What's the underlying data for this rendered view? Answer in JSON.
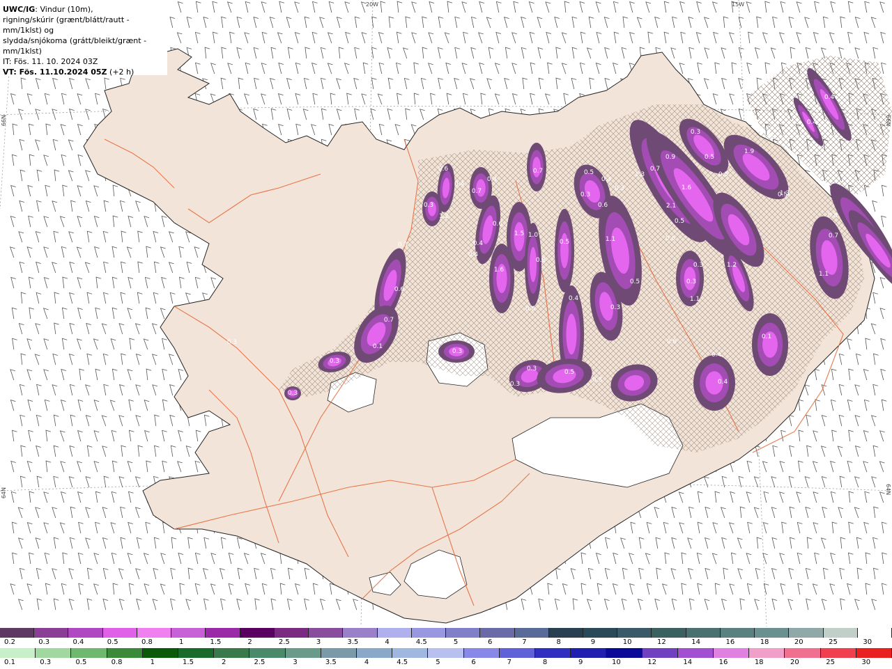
{
  "header": {
    "model": "UWC/IG",
    "title_rest": ": Vindur (10m),",
    "line2": "rigning/skúrir (grænt/blátt/rautt - mm/1klst) og",
    "line3": "slydda/snjókoma (grátt/bleikt/grænt - mm/1klst)",
    "line4": "IT: Fös. 11. 10. 2024 03Z",
    "line5_bold": "VT: Fös. 11.10.2024 05Z",
    "line5_rest": "(+2 h)"
  },
  "graticule": {
    "lon_top_left": "20W",
    "lon_top_right": "15W",
    "lat_upper_left": "66N",
    "lat_upper_right": "66N",
    "lat_lower_left": "64N",
    "lat_lower_right": "64N"
  },
  "precip_labels": [
    "0.4",
    "0.4",
    "0.3",
    "0.5",
    "1.9",
    "0.5",
    "0.5",
    "1.3",
    "0.7",
    "0.9",
    "1.6",
    "2.1",
    "0.5",
    "0.5",
    "0.4",
    "0.3",
    "0.6",
    "0.3",
    "0.6",
    "0.7",
    "0.4",
    "0.7",
    "0.4",
    "0.3",
    "1.2",
    "0.6",
    "0.4",
    "0.4",
    "1.6",
    "1.5",
    "1.0",
    "0.5",
    "1.1",
    "0.6",
    "0.8",
    "0.3",
    "0.4",
    "0.5",
    "0.3",
    "0.3",
    "0.6",
    "0.3",
    "1.1",
    "1.2",
    "1.3",
    "0.8",
    "0.7",
    "1.1",
    "0.6",
    "0.7",
    "0.6",
    "0.3",
    "0.1",
    "0.1",
    "0.3",
    "0.3",
    "0.3",
    "0.3",
    "0.5",
    "0.3",
    "0.4",
    "0.4",
    "0.3"
  ],
  "scale_snow": {
    "labels": [
      "0.2",
      "0.3",
      "0.4",
      "0.5",
      "0.8",
      "1",
      "1.5",
      "2",
      "2.5",
      "3",
      "3.5",
      "4",
      "4.5",
      "5",
      "6",
      "7",
      "8",
      "9",
      "10",
      "12",
      "14",
      "16",
      "18",
      "20",
      "25",
      "30"
    ],
    "colors": [
      "#5e3a63",
      "#8a3e96",
      "#b048c2",
      "#e060e8",
      "#f080f0",
      "#c860d8",
      "#9a2aa8",
      "#5a0060",
      "#7a2a80",
      "#8a4c9c",
      "#9a80c8",
      "#b0b0ee",
      "#9898e0",
      "#8080c8",
      "#6a6aa8",
      "#5a6a98",
      "#2a4050",
      "#2a4a5a",
      "#3a5a68",
      "#3a6060",
      "#4a7070",
      "#5a8080",
      "#6a9090",
      "#90a8a8",
      "#c0d0c8",
      "#ffffff"
    ]
  },
  "scale_rain": {
    "labels": [
      "0.1",
      "0.3",
      "0.5",
      "0.8",
      "1",
      "1.5",
      "2",
      "2.5",
      "3",
      "3.5",
      "4",
      "4.5",
      "5",
      "6",
      "7",
      "8",
      "9",
      "10",
      "12",
      "14",
      "16",
      "18",
      "20",
      "25",
      "30"
    ],
    "colors": [
      "#c8f0c8",
      "#a0d8a0",
      "#70b870",
      "#3a8a3a",
      "#0a5a0a",
      "#1a6a2a",
      "#3a7a4a",
      "#4a8a6a",
      "#6a9a8a",
      "#7a9aaa",
      "#8aa8c8",
      "#a0b8e0",
      "#b8c0f0",
      "#8888e8",
      "#6060d8",
      "#3030c0",
      "#2020b0",
      "#0a0a98",
      "#7040c0",
      "#a050d0",
      "#e080e0",
      "#f0a0c8",
      "#f07090",
      "#f04050",
      "#e82020"
    ]
  }
}
